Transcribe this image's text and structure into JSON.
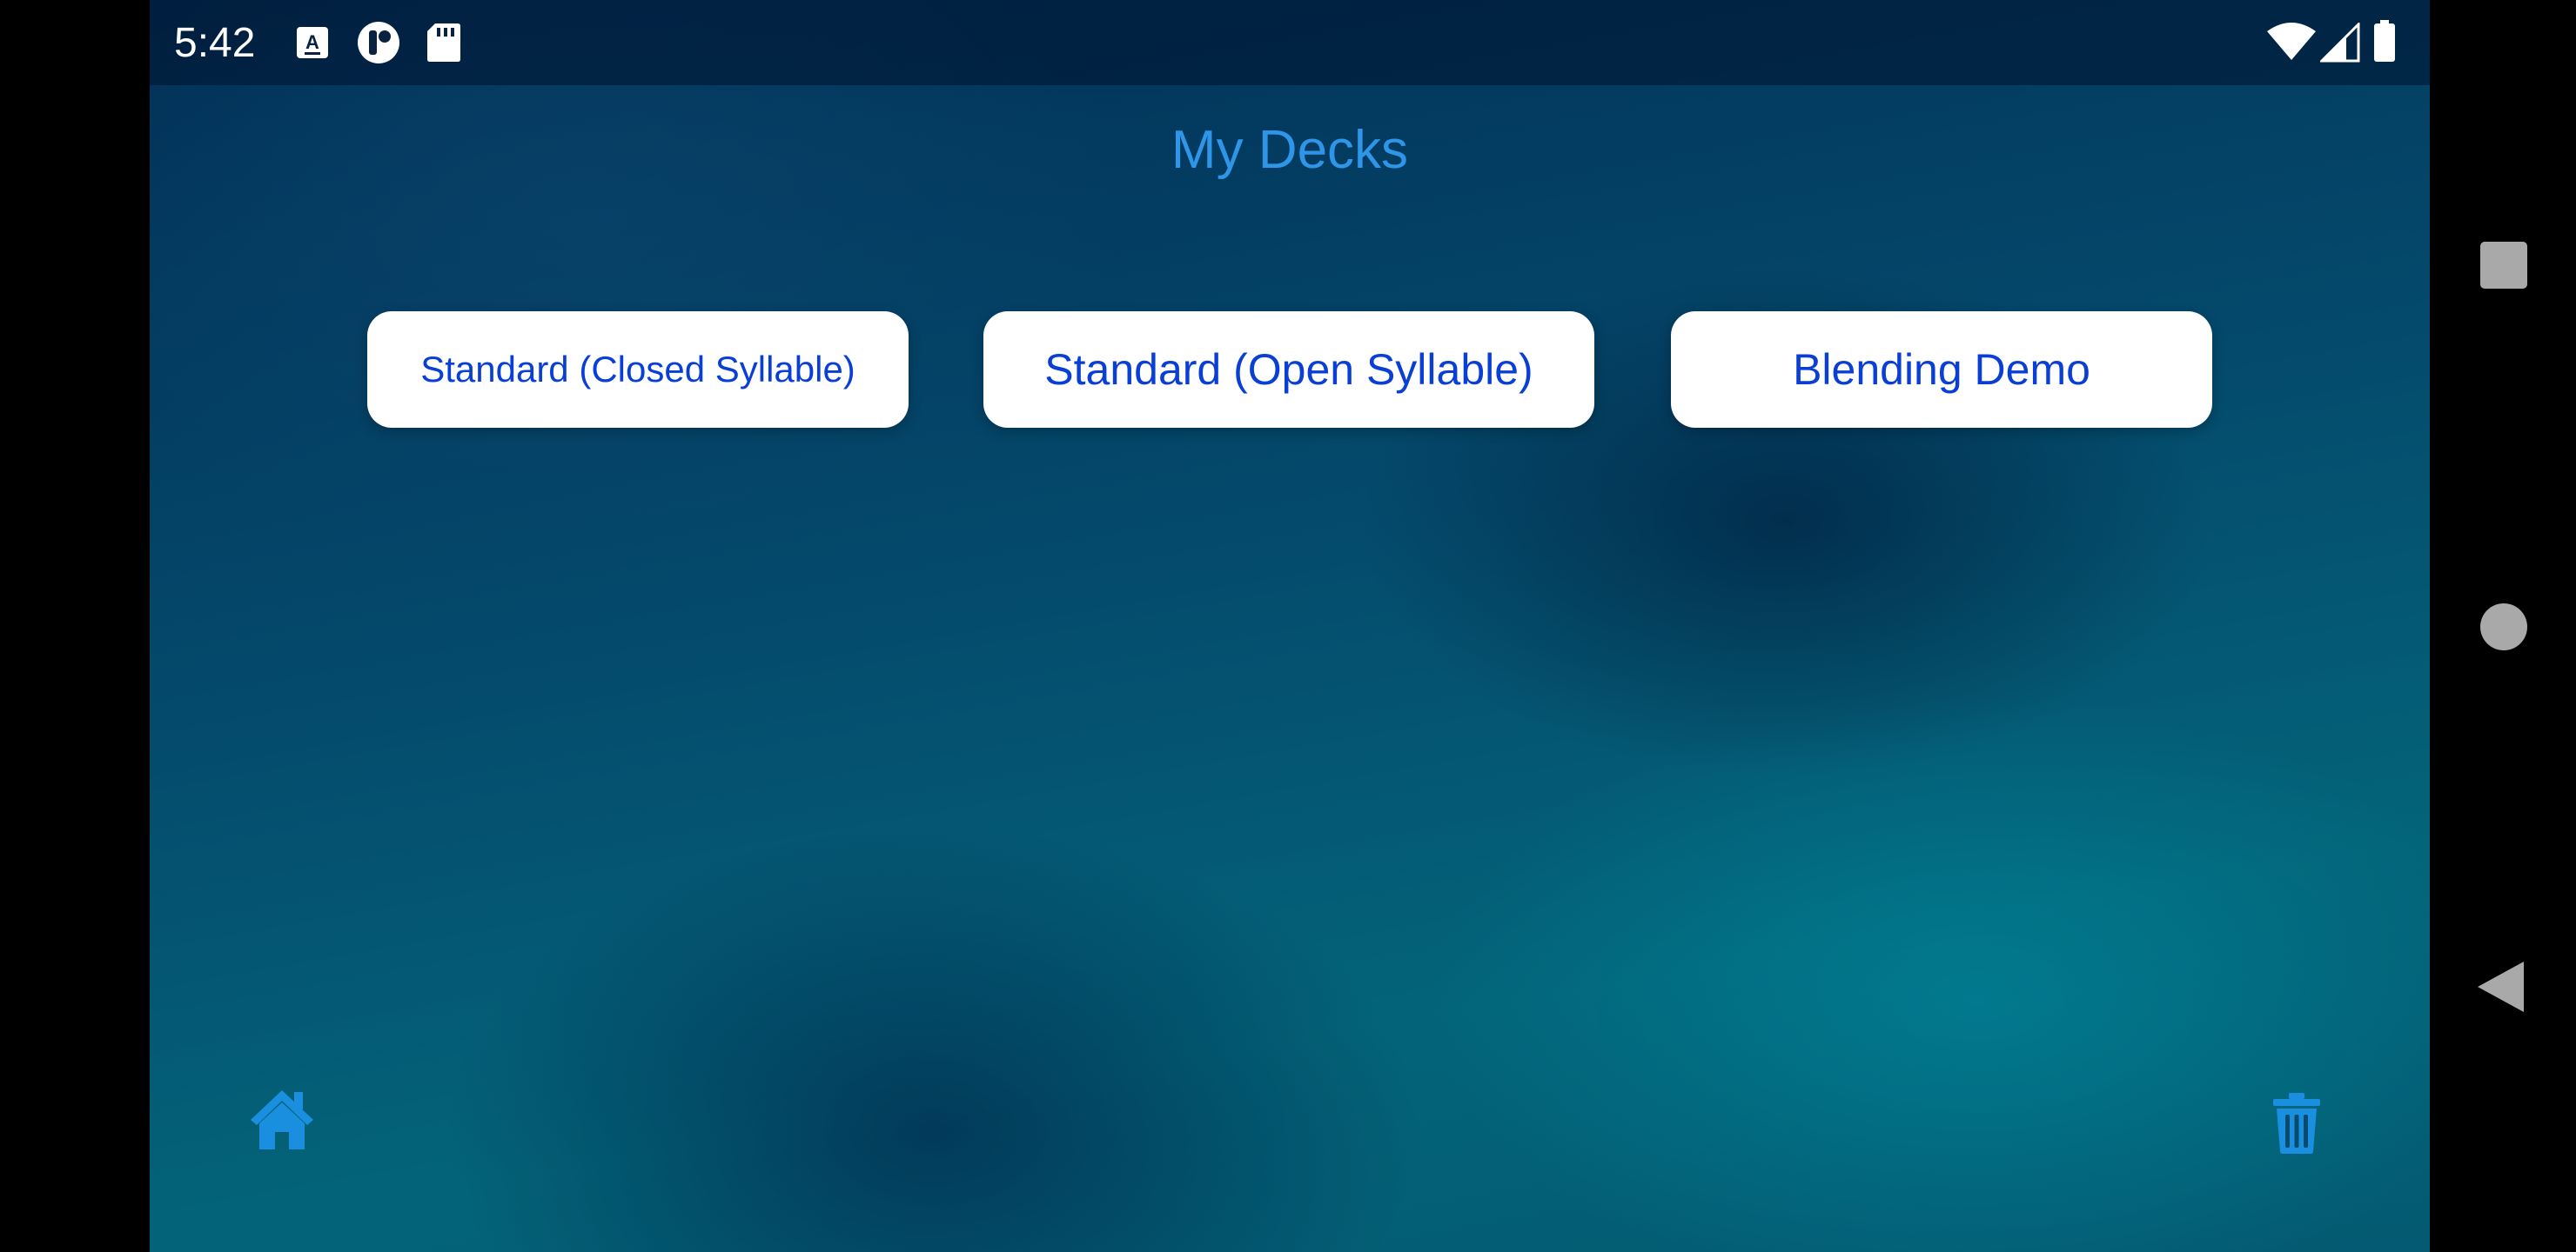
{
  "status_bar": {
    "time": "5:42",
    "left_icons": [
      "font-icon",
      "app-icon",
      "sd-card-icon"
    ],
    "right_icons": [
      "wifi-icon",
      "signal-icon",
      "battery-icon"
    ]
  },
  "page": {
    "title": "My Decks"
  },
  "decks": [
    {
      "label": "Standard (Closed Syllable)"
    },
    {
      "label": "Standard (Open Syllable)"
    },
    {
      "label": "Blending Demo"
    }
  ],
  "bottom_bar": {
    "home_icon": "home-icon",
    "trash_icon": "trash-icon"
  },
  "system_nav": {
    "icons": [
      "recents-square-icon",
      "home-circle-icon",
      "back-triangle-icon"
    ]
  },
  "colors": {
    "title": "#2e95e8",
    "button_text": "#0a3fd6",
    "button_bg": "#ffffff",
    "icon_accent": "#1a8fe0",
    "nav_icon": "#a9a9a9"
  }
}
